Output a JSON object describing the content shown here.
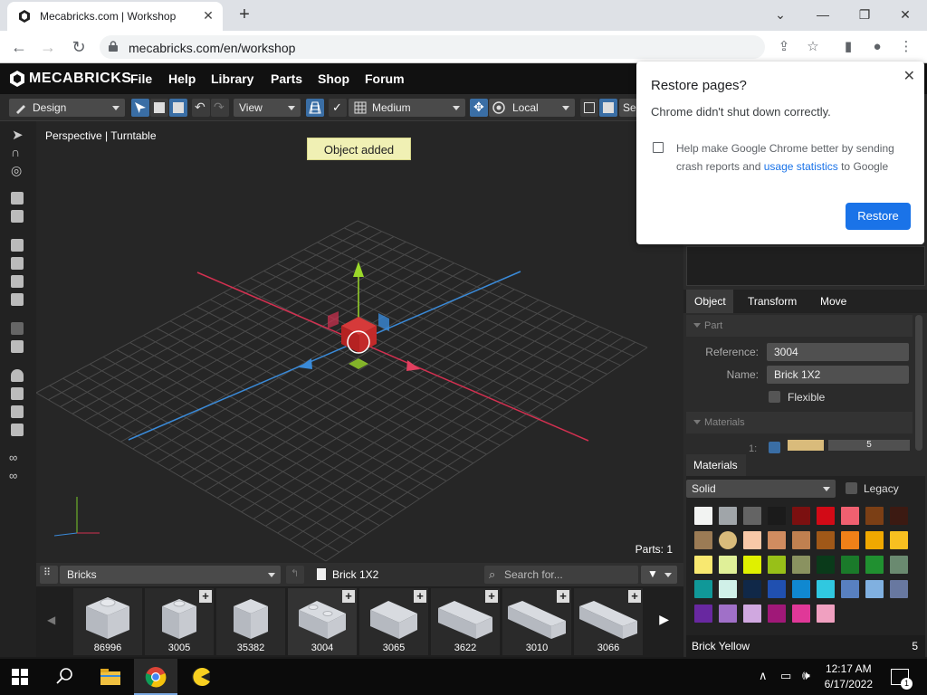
{
  "browser": {
    "tab_title": "Mecabricks.com | Workshop",
    "url": "mecabricks.com/en/workshop"
  },
  "app": {
    "logo": "MECABRICKS",
    "menu": [
      "File",
      "Help",
      "Library",
      "Parts",
      "Shop",
      "Forum"
    ]
  },
  "toolbar": {
    "mode": "Design",
    "view": "View",
    "grid": "Medium",
    "space": "Local",
    "extra": "Se"
  },
  "viewport": {
    "label": "Perspective | Turntable",
    "toast": "Object added",
    "parts_count": "Parts: 1"
  },
  "library": {
    "category": "Bricks",
    "current_part": "Brick 1X2",
    "search_placeholder": "Search for...",
    "parts": [
      {
        "id": "86996"
      },
      {
        "id": "3005"
      },
      {
        "id": "35382"
      },
      {
        "id": "3004"
      },
      {
        "id": "3065"
      },
      {
        "id": "3622"
      },
      {
        "id": "3010"
      },
      {
        "id": "3066"
      }
    ]
  },
  "panel": {
    "tabs": [
      "Object",
      "Transform",
      "Move"
    ],
    "part_section": "Part",
    "reference_label": "Reference:",
    "reference_value": "3004",
    "name_label": "Name:",
    "name_value": "Brick 1X2",
    "flexible_label": "Flexible",
    "materials_section": "Materials",
    "materials_row_index": "1:",
    "materials_row_value": "5"
  },
  "materials": {
    "tab": "Materials",
    "type": "Solid",
    "legacy_label": "Legacy",
    "selected_name": "Brick Yellow",
    "selected_id": "5",
    "swatches": [
      "#f2f3f2",
      "#a0a5a9",
      "#646464",
      "#1b1b1b",
      "#7b1010",
      "#d20a16",
      "#f06070",
      "#7b3f15",
      "#3c1a12",
      "#9b7b55",
      "#d9bb7b",
      "#f8c8a8",
      "#d08c60",
      "#c08050",
      "#a05818",
      "#f08018",
      "#f0a800",
      "#f8c020",
      "#f8e870",
      "#e0f098",
      "#e0f000",
      "#98c018",
      "#8a9260",
      "#0a3a1a",
      "#1a7a2a",
      "#209030",
      "#6a8a70",
      "#109898",
      "#d0f0e8",
      "#102848",
      "#2050b0",
      "#1088d0",
      "#30c8e0",
      "#5880c0",
      "#80b0e0",
      "#6878a0",
      "#6828a0",
      "#a070c8",
      "#d0a8e0",
      "#a01878",
      "#e03898",
      "#f0a0c0"
    ]
  },
  "restore": {
    "title": "Restore pages?",
    "subtitle": "Chrome didn't shut down correctly.",
    "checkbox_text_1": "Help make Google Chrome better by sending crash reports and ",
    "checkbox_link": "usage statistics",
    "checkbox_text_2": " to Google",
    "button": "Restore"
  },
  "taskbar": {
    "time": "12:17 AM",
    "date": "6/17/2022",
    "notifications": "1"
  }
}
